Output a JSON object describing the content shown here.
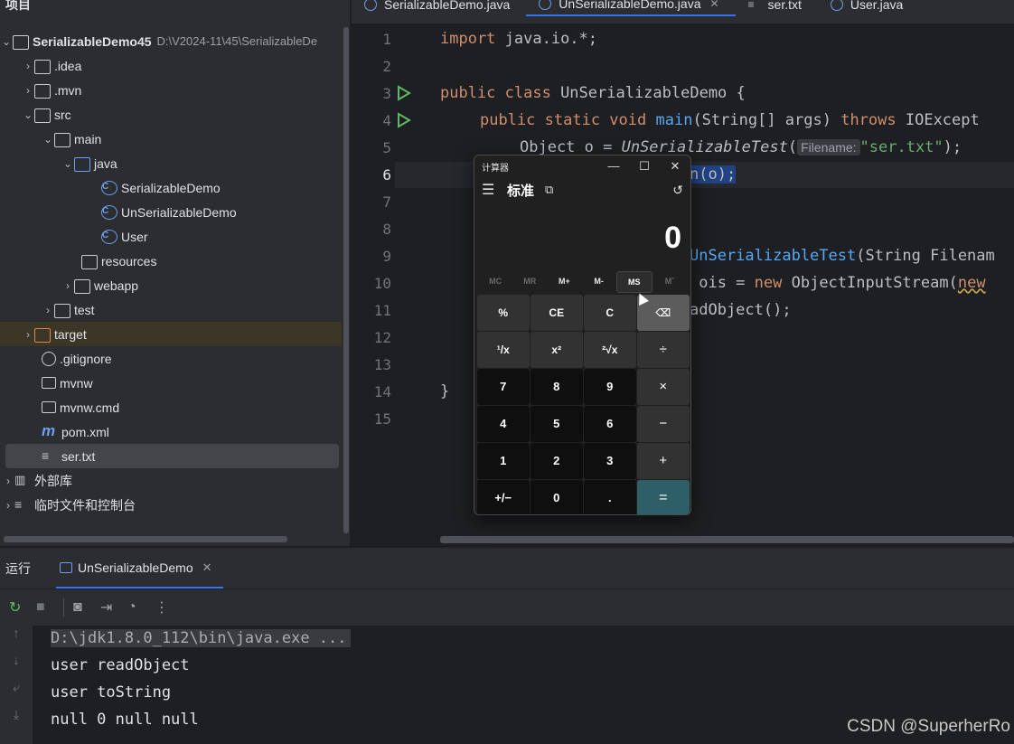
{
  "project": {
    "header": "项目",
    "root_name": "SerializableDemo45",
    "root_path": "D:\\V2024-11\\45\\SerializableDe",
    "items": [
      {
        "label": ".idea"
      },
      {
        "label": ".mvn"
      },
      {
        "label": "src"
      },
      {
        "label": "main"
      },
      {
        "label": "java"
      },
      {
        "label": "SerializableDemo"
      },
      {
        "label": "UnSerializableDemo"
      },
      {
        "label": "User"
      },
      {
        "label": "resources"
      },
      {
        "label": "webapp"
      },
      {
        "label": "test"
      },
      {
        "label": "target"
      },
      {
        "label": ".gitignore"
      },
      {
        "label": "mvnw"
      },
      {
        "label": "mvnw.cmd"
      },
      {
        "label": "pom.xml"
      },
      {
        "label": "ser.txt"
      },
      {
        "label": "外部库"
      },
      {
        "label": "临时文件和控制台"
      }
    ]
  },
  "editor": {
    "tabs": [
      {
        "label": "SerializableDemo.java"
      },
      {
        "label": "UnSerializableDemo.java"
      },
      {
        "label": "ser.txt"
      },
      {
        "label": "User.java"
      }
    ],
    "line_numbers": [
      "1",
      "2",
      "3",
      "4",
      "5",
      "6",
      "7",
      "8",
      "9",
      "10",
      "11",
      "12",
      "13",
      "14",
      "15"
    ],
    "code": {
      "l1_kw": "import",
      "l1_rest": " java.io.*;",
      "l3_kw": "public class",
      "l3_rest": " UnSerializableDemo {",
      "l4_kw1": "public static void",
      "l4_fn": "main",
      "l4_mid": "(String[] args) ",
      "l4_kw2": "throws",
      "l4_rest": " IOExcept",
      "l5_a": "Object o = ",
      "l5_it": "UnSerializableTest",
      "l5_paren": "(",
      "l5_hint": "Filename:",
      "l5_str": "\"ser.txt\"",
      "l5_end": ");",
      "l6_sel": "n(o);",
      "l9_fn": "UnSerializableTest",
      "l9_rest": "(String Filenam",
      "l10_a": " ois = ",
      "l10_kw": "new",
      "l10_b": " ObjectInputStream(",
      "l10_kw2": "new",
      "l11": "adObject();",
      "l14": "}"
    }
  },
  "calculator": {
    "title": "计算器",
    "controls": [
      "—",
      "☐",
      "✕"
    ],
    "mode": "标准",
    "display": "0",
    "memory": [
      "MC",
      "MR",
      "M+",
      "M-",
      "MS",
      "Mˇ"
    ],
    "keys": [
      "%",
      "CE",
      "C",
      "⌫",
      "¹/x",
      "x²",
      "²√x",
      "÷",
      "7",
      "8",
      "9",
      "×",
      "4",
      "5",
      "6",
      "−",
      "1",
      "2",
      "3",
      "+",
      "+/−",
      "0",
      ".",
      "="
    ]
  },
  "run": {
    "title": "运行",
    "tab_label": "UnSerializableDemo",
    "console": [
      "D:\\jdk1.8.0_112\\bin\\java.exe ...",
      "user readObject",
      "user toString",
      "null 0 null null"
    ]
  },
  "watermark": "CSDN @SuperherRo"
}
